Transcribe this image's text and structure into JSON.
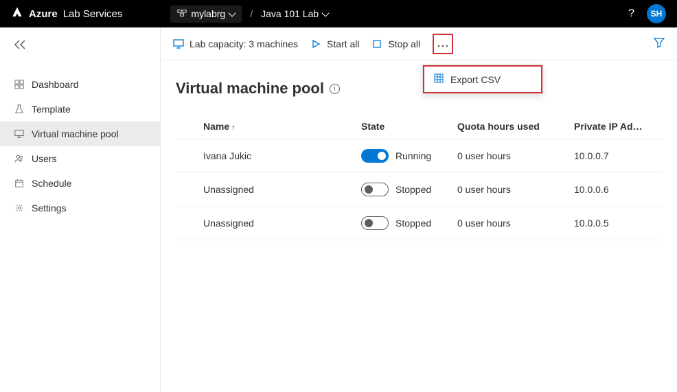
{
  "header": {
    "brand_bold": "Azure",
    "brand_rest": "Lab Services",
    "resource_group": "mylabrg",
    "lab_name": "Java 101 Lab",
    "breadcrumb_separator": "/",
    "help": "?",
    "user_initials": "SH"
  },
  "sidebar": {
    "items": [
      {
        "label": "Dashboard"
      },
      {
        "label": "Template"
      },
      {
        "label": "Virtual machine pool"
      },
      {
        "label": "Users"
      },
      {
        "label": "Schedule"
      },
      {
        "label": "Settings"
      }
    ]
  },
  "toolbar": {
    "capacity": "Lab capacity: 3 machines",
    "start_all": "Start all",
    "stop_all": "Stop all",
    "more_menu": {
      "export_csv": "Export CSV"
    }
  },
  "page": {
    "title": "Virtual machine pool",
    "info_glyph": "i"
  },
  "table": {
    "columns": {
      "name": "Name",
      "state": "State",
      "quota": "Quota hours used",
      "ip": "Private IP Ad…"
    },
    "rows": [
      {
        "name": "Ivana Jukic",
        "state": "Running",
        "on": true,
        "quota": "0 user hours",
        "ip": "10.0.0.7"
      },
      {
        "name": "Unassigned",
        "state": "Stopped",
        "on": false,
        "quota": "0 user hours",
        "ip": "10.0.0.6"
      },
      {
        "name": "Unassigned",
        "state": "Stopped",
        "on": false,
        "quota": "0 user hours",
        "ip": "10.0.0.5"
      }
    ]
  }
}
